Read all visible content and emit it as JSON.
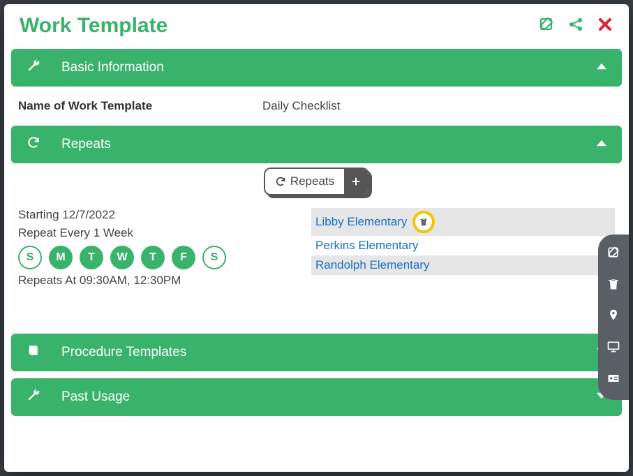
{
  "header": {
    "title": "Work Template"
  },
  "sections": {
    "basic": "Basic Information",
    "repeats": "Repeats",
    "procedure": "Procedure Templates",
    "past": "Past Usage"
  },
  "basic": {
    "name_label": "Name of Work Template",
    "name_value": "Daily Checklist"
  },
  "repeats_tab": {
    "label": "Repeats"
  },
  "repeat_config": {
    "starting": "Starting 12/7/2022",
    "interval": "Repeat Every 1 Week",
    "days": [
      {
        "letter": "S",
        "on": false
      },
      {
        "letter": "M",
        "on": true
      },
      {
        "letter": "T",
        "on": true
      },
      {
        "letter": "W",
        "on": true
      },
      {
        "letter": "T",
        "on": true
      },
      {
        "letter": "F",
        "on": true
      },
      {
        "letter": "S",
        "on": false
      }
    ],
    "times": "Repeats At 09:30AM, 12:30PM"
  },
  "locations": [
    {
      "name": "Libby Elementary",
      "alt": true,
      "highlighted": true
    },
    {
      "name": "Perkins Elementary",
      "alt": false,
      "highlighted": false
    },
    {
      "name": "Randolph Elementary",
      "alt": true,
      "highlighted": false
    }
  ]
}
